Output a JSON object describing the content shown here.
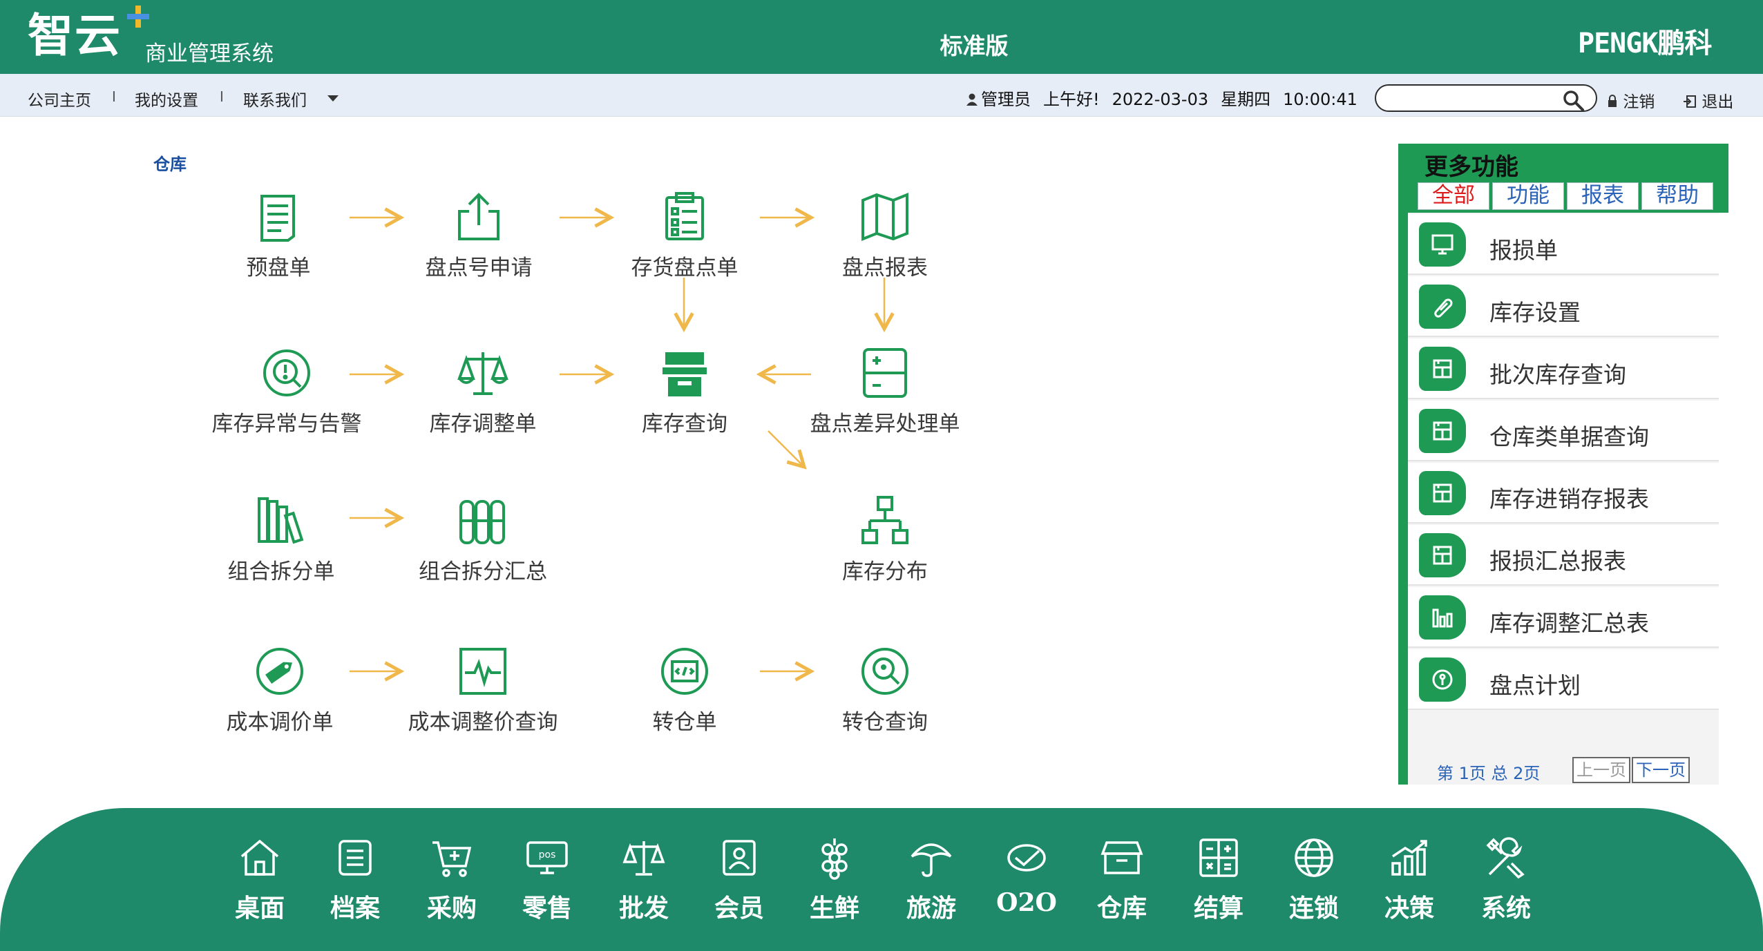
{
  "header": {
    "logo_main": "智云",
    "logo_sub": "商业管理系统",
    "edition": "标准版",
    "brand": "PENGK鹏科"
  },
  "nav": {
    "links": [
      "公司主页",
      "我的设置",
      "联系我们"
    ],
    "separator": "I",
    "user": "管理员",
    "greeting": "上午好!",
    "date": "2022-03-03",
    "weekday": "星期四",
    "time": "10:00:41",
    "search_value": "",
    "logout": "注销",
    "exit": "退出"
  },
  "breadcrumb": "仓库",
  "flow": {
    "nodes": {
      "pre_count": "预盘单",
      "count_no_apply": "盘点号申请",
      "stock_count": "存货盘点单",
      "count_report": "盘点报表",
      "stock_alert": "库存异常与告警",
      "stock_adjust": "库存调整单",
      "stock_query": "库存查询",
      "count_diff": "盘点差异处理单",
      "combo_split": "组合拆分单",
      "combo_summary": "组合拆分汇总",
      "stock_dist": "库存分布",
      "cost_adjust": "成本调价单",
      "cost_adjust_query": "成本调整价查询",
      "transfer": "转仓单",
      "transfer_query": "转仓查询"
    }
  },
  "panel": {
    "title": "更多功能",
    "tabs": [
      "全部",
      "功能",
      "报表",
      "帮助"
    ],
    "items": [
      "报损单",
      "库存设置",
      "批次库存查询",
      "仓库类单据查询",
      "库存进销存报表",
      "报损汇总报表",
      "库存调整汇总表",
      "盘点计划"
    ],
    "pager": "第 1页 总 2页",
    "prev": "上一页",
    "next": "下一页"
  },
  "dock": {
    "items": [
      "桌面",
      "档案",
      "采购",
      "零售",
      "批发",
      "会员",
      "生鲜",
      "旅游",
      "O2O",
      "仓库",
      "结算",
      "连锁",
      "决策",
      "系统"
    ]
  },
  "colors": {
    "header": "#1e8a6a",
    "accent_green": "#1e9a55",
    "arrow": "#f0b84a",
    "nav_bg": "#e7edf6"
  }
}
